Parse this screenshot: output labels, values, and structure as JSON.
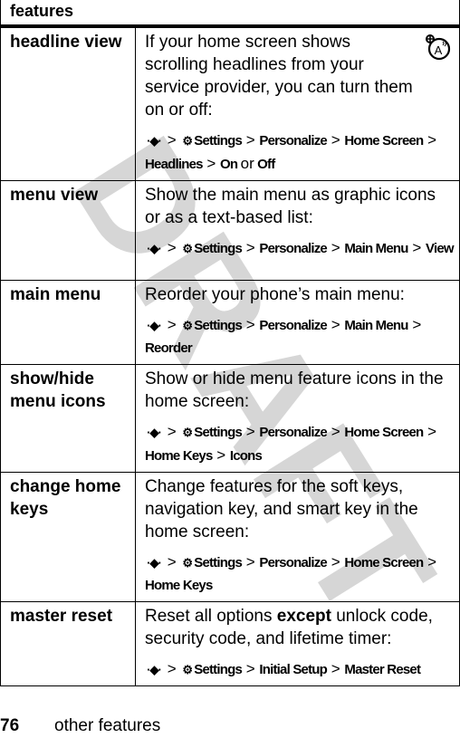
{
  "watermark": "DRAFT",
  "table": {
    "header": "features",
    "rows": [
      {
        "term": "headline view",
        "desc": "If your home screen shows scrolling headlines from your service provider, you can turn them on or off:",
        "icon": "network-feature-icon",
        "path": [
          "Settings",
          "Personalize",
          "Home Screen",
          "Headlines"
        ],
        "path_tail": {
          "a": "On",
          "or": "or",
          "b": "Off"
        }
      },
      {
        "term": "menu view",
        "desc": "Show the main menu as graphic icons or as a text-based list:",
        "path": [
          "Settings",
          "Personalize",
          "Main Menu",
          "View"
        ]
      },
      {
        "term": "main menu",
        "desc": "Reorder your phone’s main menu:",
        "path": [
          "Settings",
          "Personalize",
          "Main Menu",
          "Reorder"
        ]
      },
      {
        "term": "show/hide menu icons",
        "desc": "Show or hide menu feature icons in the home screen:",
        "path": [
          "Settings",
          "Personalize",
          "Home Screen",
          "Home Keys",
          "Icons"
        ]
      },
      {
        "term": "change home keys",
        "desc": "Change features for the soft keys, navigation key, and smart key in the home screen:",
        "path": [
          "Settings",
          "Personalize",
          "Home Screen",
          "Home Keys"
        ]
      },
      {
        "term": "master reset",
        "desc_parts": {
          "a": "Reset all options ",
          "b": "except",
          "c": " unlock code, security code, and lifetime timer:"
        },
        "path": [
          "Settings",
          "Initial Setup",
          "Master Reset"
        ]
      }
    ]
  },
  "footer": {
    "page_number": "76",
    "title": "other features"
  }
}
